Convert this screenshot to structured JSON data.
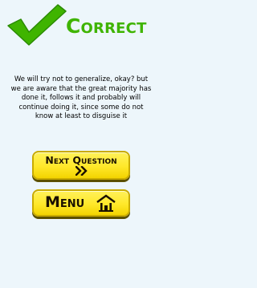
{
  "header": {
    "title": "Correct",
    "check_icon": "check-mark-icon",
    "title_color": "#3fb400"
  },
  "message": {
    "text": "We will try not to generalize, okay? but we are aware that the great majority has done it, follows it and probably will continue doing it, since some do not know at least to disguise it"
  },
  "buttons": {
    "next_label": "Next Question",
    "next_icon": "double-chevron-right-icon",
    "menu_label": "Menu",
    "menu_icon": "home-icon",
    "button_color": "#ffe82a"
  }
}
